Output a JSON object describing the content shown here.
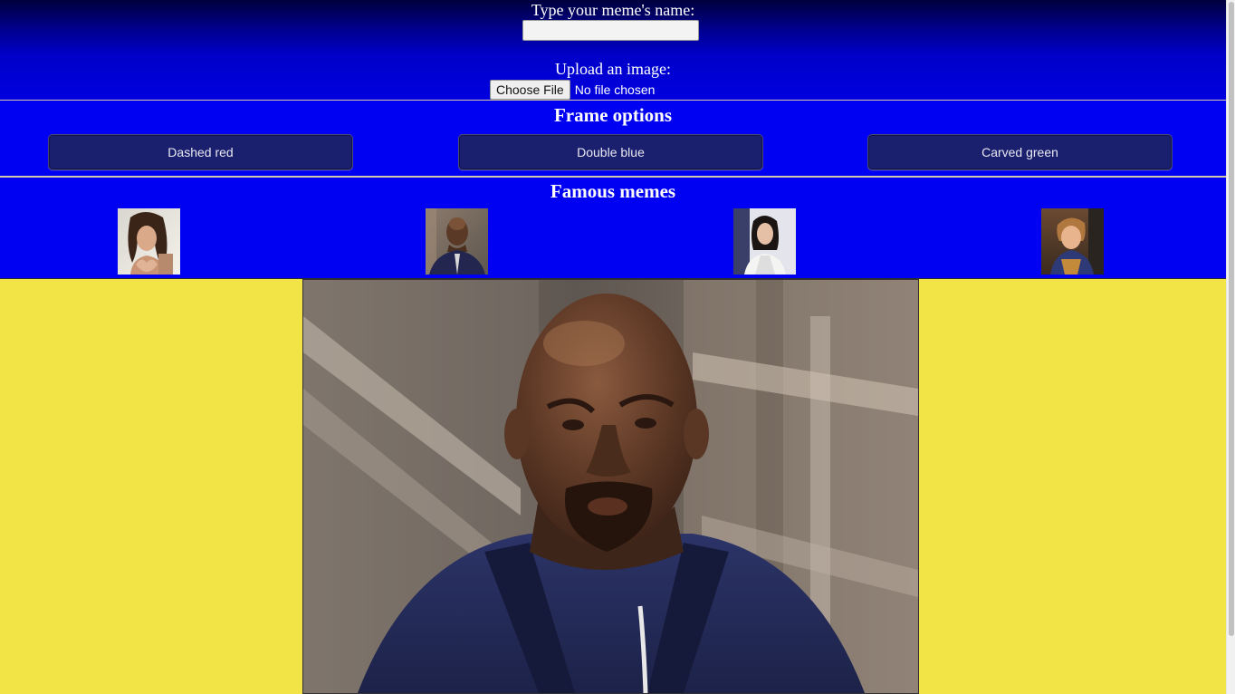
{
  "upload": {
    "name_label": "Type your meme's name:",
    "name_value": "",
    "upload_label": "Upload an image:",
    "choose_file_label": "Choose File",
    "no_file_text": "No file chosen"
  },
  "frame_options": {
    "title": "Frame options",
    "buttons": [
      {
        "label": "Dashed red"
      },
      {
        "label": "Double blue"
      },
      {
        "label": "Carved green"
      }
    ]
  },
  "famous_memes": {
    "title": "Famous memes",
    "thumbnails": [
      {
        "name": "woman-heart-hands-thumbnail"
      },
      {
        "name": "bald-man-thumbnail"
      },
      {
        "name": "woman-dark-hair-thumbnail"
      },
      {
        "name": "child-thumbnail"
      }
    ]
  },
  "main_meme": {
    "name": "bald-man-confused-image"
  },
  "colors": {
    "page_background": "#f2e447",
    "section_blue": "#0000f2",
    "header_gradient_top": "#00003d",
    "button_navy": "#1a1f6e"
  }
}
